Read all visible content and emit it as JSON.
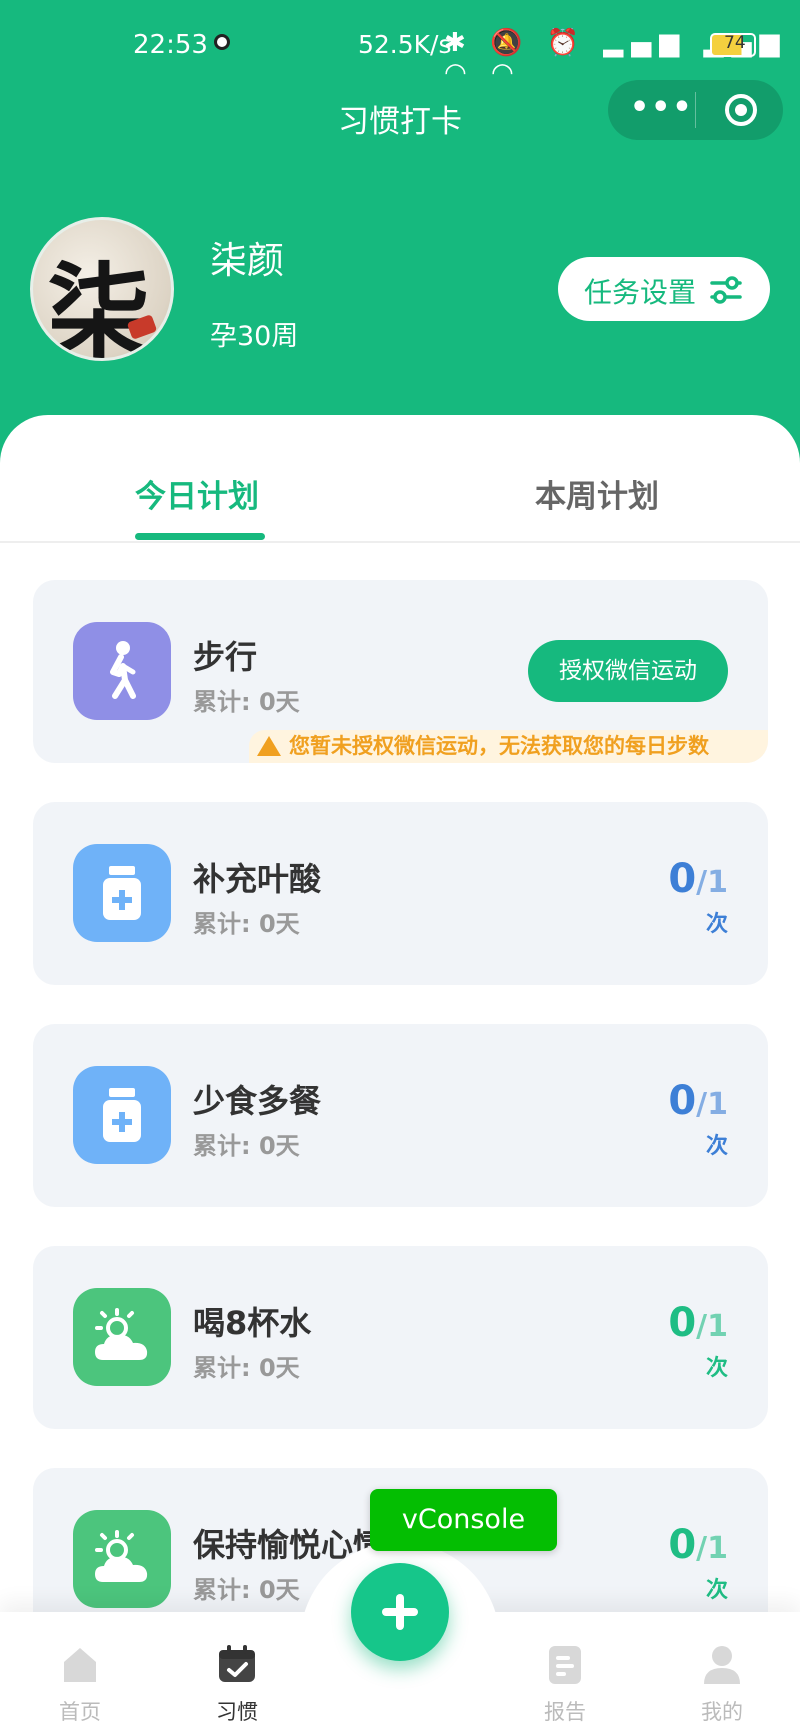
{
  "status_bar": {
    "time": "22:53",
    "speed": "52.5K/s",
    "battery": "74",
    "icons_text": "✱ 🔕 ⏰ ▂▄▆ ▂▄▆ ◠ ◠"
  },
  "nav": {
    "title": "习惯打卡",
    "more_glyph": "•••"
  },
  "profile": {
    "avatar_char": "柒",
    "name": "柒颜",
    "pregnancy_week": "孕30周",
    "task_settings_label": "任务设置"
  },
  "tabs": [
    {
      "label": "今日计划",
      "active": true
    },
    {
      "label": "本周计划",
      "active": false
    }
  ],
  "habits": [
    {
      "name": "步行",
      "total": "累计: 0天",
      "icon": "walking-icon",
      "color": "#8f8fe6",
      "action_label": "授权微信运动",
      "warning": "您暂未授权微信运动，无法获取您的每日步数"
    },
    {
      "name": "补充叶酸",
      "total": "累计: 0天",
      "icon": "medicine-bottle-icon",
      "color": "#6fb2f8",
      "done": "0",
      "target": "1",
      "unit": "次"
    },
    {
      "name": "少食多餐",
      "total": "累计: 0天",
      "icon": "medicine-bottle-icon",
      "color": "#6fb2f8",
      "done": "0",
      "target": "1",
      "unit": "次"
    },
    {
      "name": "喝8杯水",
      "total": "累计: 0天",
      "icon": "sun-cloud-icon",
      "color": "#4cc57d",
      "done": "0",
      "target": "1",
      "unit": "次"
    },
    {
      "name": "保持愉悦心情",
      "total": "累计: 0天",
      "icon": "sun-cloud-icon",
      "color": "#4cc57d",
      "done": "0",
      "target": "1",
      "unit": "次"
    }
  ],
  "vconsole": {
    "label": "vConsole"
  },
  "tabbar": [
    {
      "label": "首页",
      "icon": "home-icon",
      "active": false
    },
    {
      "label": "习惯",
      "icon": "calendar-check-icon",
      "active": true
    },
    {
      "label": "报告",
      "icon": "report-icon",
      "active": false
    },
    {
      "label": "我的",
      "icon": "user-icon",
      "active": false
    }
  ]
}
